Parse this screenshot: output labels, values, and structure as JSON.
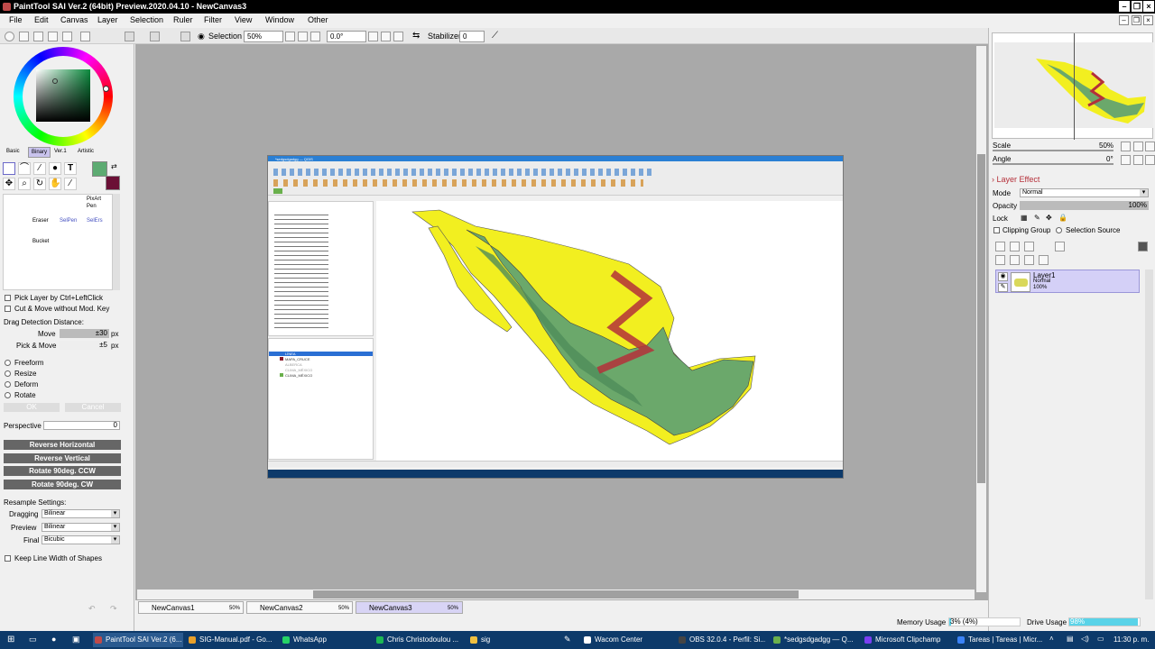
{
  "window": {
    "title": "PaintTool SAI Ver.2 (64bit) Preview.2020.04.10 - NewCanvas3"
  },
  "menu": [
    "File",
    "Edit",
    "Canvas",
    "Layer",
    "Selection",
    "Ruler",
    "Filter",
    "View",
    "Window",
    "Other"
  ],
  "toolbar": {
    "selection_label": "Selection",
    "zoom": "50%",
    "angle": "0.0°",
    "stabilizer_label": "Stabilizer",
    "stabilizer_value": "0"
  },
  "left": {
    "color_tabs": [
      "Basic",
      "Binary",
      "Ver.1",
      "Artistic"
    ],
    "brushes": {
      "pixart": "PixArt",
      "pen": "Pen",
      "eraser": "Eraser",
      "selpen": "SelPen",
      "selers": "SelErs",
      "bucket": "Bucket"
    },
    "pick_layer": "Pick Layer by Ctrl+LeftClick",
    "cut_move": "Cut & Move without Mod. Key",
    "drag_detect": "Drag Detection Distance:",
    "move_label": "Move",
    "move_value": "±30",
    "move_unit": "px",
    "pickmove_label": "Pick & Move",
    "pickmove_value": "±5",
    "pickmove_unit": "px",
    "transforms": [
      "Freeform",
      "Resize",
      "Deform",
      "Rotate"
    ],
    "ok": "OK",
    "cancel": "Cancel",
    "perspective_label": "Perspective",
    "perspective_value": "0",
    "actions": [
      "Reverse Horizontal",
      "Reverse Vertical",
      "Rotate 90deg. CCW",
      "Rotate 90deg. CW"
    ],
    "resample_label": "Resample Settings:",
    "resample": [
      {
        "label": "Dragging",
        "value": "Bilinear"
      },
      {
        "label": "Preview",
        "value": "Bilinear"
      },
      {
        "label": "Final",
        "value": "Bicubic"
      }
    ],
    "keep_line": "Keep Line Width of Shapes"
  },
  "right": {
    "scale_label": "Scale",
    "scale_value": "50%",
    "angle_label": "Angle",
    "angle_value": "0°",
    "layer_effect": "Layer Effect",
    "mode_label": "Mode",
    "mode_value": "Normal",
    "opacity_label": "Opacity",
    "opacity_value": "100%",
    "lock_label": "Lock",
    "clipping_group": "Clipping Group",
    "selection_source": "Selection Source",
    "layer": {
      "name": "Layer1",
      "mode": "Normal",
      "opacity": "100%"
    }
  },
  "doc_tabs": [
    {
      "name": "NewCanvas1",
      "zoom": "50%"
    },
    {
      "name": "NewCanvas2",
      "zoom": "50%"
    },
    {
      "name": "NewCanvas3",
      "zoom": "50%"
    }
  ],
  "status": {
    "memory_label": "Memory Usage",
    "memory_value": "3% (4%)",
    "drive_label": "Drive Usage",
    "drive_value": "98%",
    "memory_fraction": 0.03,
    "drive_fraction": 0.98
  },
  "qgis": {
    "title": "*sedgsdgadgg — QGIS",
    "layers": [
      "LÍNEA",
      "MAPA_CRUCE",
      "ALBERCA",
      "CLIMA_MÉXICO",
      "CLIMA_MÉXICO"
    ]
  },
  "taskbar": {
    "items": [
      {
        "label": "PaintTool SAI Ver.2 (6...",
        "color": "#c04a4a"
      },
      {
        "label": "SIG-Manual.pdf - Go...",
        "color": "#e8a02a"
      },
      {
        "label": "WhatsApp",
        "color": "#25d366"
      },
      {
        "label": "Chris Christodoulou ...",
        "color": "#1db954"
      },
      {
        "label": "sig",
        "color": "#f0c040"
      },
      {
        "label": "Wacom Center",
        "color": "#ffffff"
      },
      {
        "label": "OBS 32.0.4 - Perfil: Si...",
        "color": "#444444"
      },
      {
        "label": "*sedgsdgadgg — Q...",
        "color": "#6ab04c"
      },
      {
        "label": "Microsoft Clipchamp",
        "color": "#7b3ff2"
      },
      {
        "label": "Tareas | Tareas | Micr...",
        "color": "#3b82f6"
      }
    ],
    "time": "11:30 p. m."
  }
}
